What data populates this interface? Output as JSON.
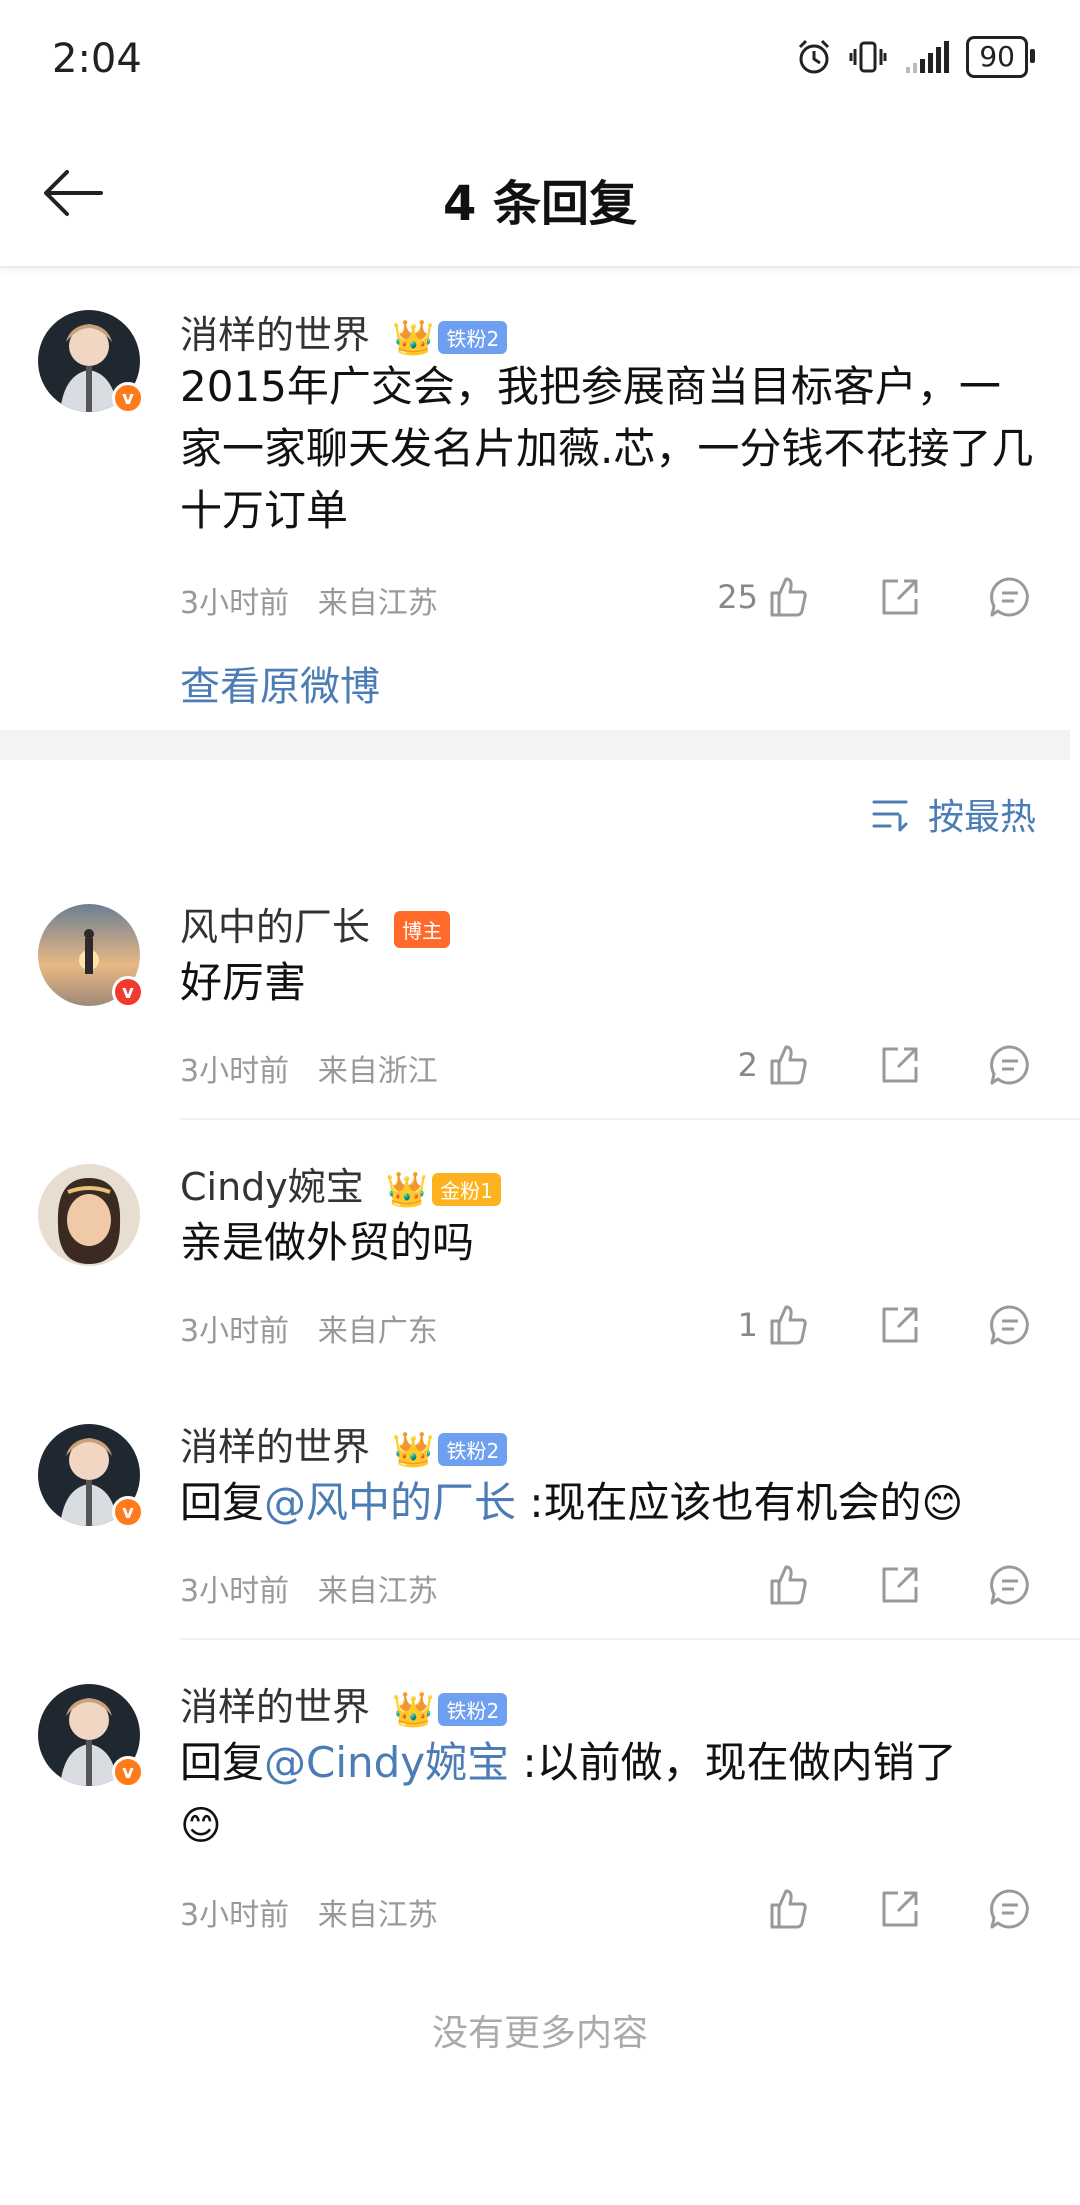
{
  "status_bar": {
    "time": "2:04",
    "battery": "90"
  },
  "nav": {
    "title": "4 条回复"
  },
  "post": {
    "username": "消样的世界",
    "fan_level": "铁粉2",
    "content": "2015年广交会，我把参展商当目标客户，一家一家聊天发名片加薇.芯，一分钱不花接了几十万订单",
    "time": "3小时前",
    "location": "来自江苏",
    "like_count": "25",
    "view_original": "查看原微博"
  },
  "sort": {
    "label": "按最热"
  },
  "replies": [
    {
      "username": "风中的厂长",
      "tag": "博主",
      "content": "好厉害",
      "time": "3小时前",
      "location": "来自浙江",
      "like_count": "2"
    },
    {
      "username": "Cindy婉宝",
      "fan_level": "金粉1",
      "content": "亲是做外贸的吗",
      "time": "3小时前",
      "location": "来自广东",
      "like_count": "1"
    },
    {
      "username": "消样的世界",
      "fan_level": "铁粉2",
      "reply_prefix": "回复",
      "mention": "@风中的厂长",
      "content": " :现在应该也有机会的",
      "emoji": "😊",
      "time": "3小时前",
      "location": "来自江苏",
      "like_count": ""
    },
    {
      "username": "消样的世界",
      "fan_level": "铁粉2",
      "reply_prefix": "回复",
      "mention": "@Cindy婉宝",
      "content": " :以前做，现在做内销了",
      "emoji": "😊",
      "time": "3小时前",
      "location": "来自江苏",
      "like_count": ""
    }
  ],
  "footer": {
    "no_more": "没有更多内容"
  },
  "icons": {
    "back": "back-arrow-icon",
    "like": "thumbs-up-icon",
    "share": "share-icon",
    "comment": "comment-icon",
    "sort": "sort-lines-icon",
    "crown": "crown-icon",
    "verified": "verified-v-icon"
  },
  "colors": {
    "link": "#4b7cb5",
    "meta": "#999999",
    "verified": "#ff7a1a",
    "host_tag": "#ff6a2a",
    "iron_fan": "#6e9ff0",
    "gold_fan": "#ffb21f"
  }
}
